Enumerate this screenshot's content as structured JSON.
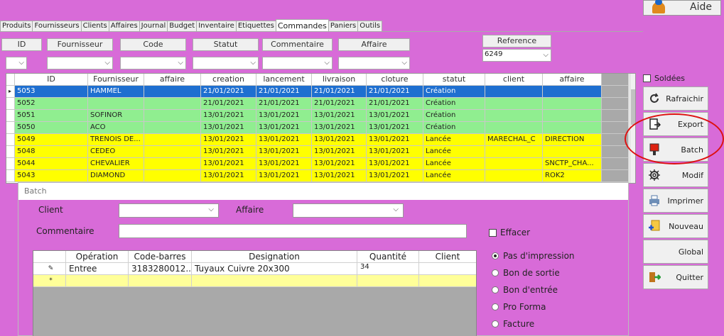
{
  "aide_label": "Aide",
  "tabs": [
    "Produits",
    "Fournisseurs",
    "Clients",
    "Affaires",
    "Journal",
    "Budget",
    "Inventaire",
    "Etiquettes",
    "Commandes",
    "Paniers",
    "Outils"
  ],
  "active_tab": "Commandes",
  "filters": {
    "id_label": "ID",
    "fournisseur_label": "Fournisseur",
    "code_label": "Code",
    "statut_label": "Statut",
    "commentaire_label": "Commentaire",
    "affaire_label": "Affaire",
    "reference_label": "Reference",
    "reference_value": "6249"
  },
  "grid": {
    "columns": [
      "ID",
      "Fournisseur",
      "affaire",
      "creation",
      "lancement",
      "livraison",
      "cloture",
      "statut",
      "client",
      "affaire"
    ],
    "rows": [
      {
        "cells": [
          "5053",
          "HAMMEL",
          "",
          "21/01/2021",
          "21/01/2021",
          "21/01/2021",
          "21/01/2021",
          "Création",
          "",
          ""
        ],
        "color": "#1e6fd0",
        "selected": true
      },
      {
        "cells": [
          "5052",
          "",
          "",
          "21/01/2021",
          "21/01/2021",
          "21/01/2021",
          "21/01/2021",
          "Création",
          "",
          ""
        ],
        "color": "#90ee90"
      },
      {
        "cells": [
          "5051",
          "SOFINOR",
          "",
          "13/01/2021",
          "13/01/2021",
          "13/01/2021",
          "13/01/2021",
          "Création",
          "",
          ""
        ],
        "color": "#90ee90"
      },
      {
        "cells": [
          "5050",
          "ACO",
          "",
          "13/01/2021",
          "13/01/2021",
          "13/01/2021",
          "13/01/2021",
          "Création",
          "",
          ""
        ],
        "color": "#90ee90"
      },
      {
        "cells": [
          "5049",
          "TRENOIS DE...",
          "",
          "13/01/2021",
          "13/01/2021",
          "13/01/2021",
          "13/01/2021",
          "Lancée",
          "MARECHAL_C",
          "DIRECTION"
        ],
        "color": "#ffff00"
      },
      {
        "cells": [
          "5048",
          "CEDEO",
          "",
          "13/01/2021",
          "13/01/2021",
          "13/01/2021",
          "13/01/2021",
          "Lancée",
          "",
          ""
        ],
        "color": "#ffff00"
      },
      {
        "cells": [
          "5044",
          "CHEVALIER",
          "",
          "13/01/2021",
          "13/01/2021",
          "13/01/2021",
          "13/01/2021",
          "Lancée",
          "",
          "SNCTP_CHA..."
        ],
        "color": "#ffff00"
      },
      {
        "cells": [
          "5043",
          "DIAMOND",
          "",
          "13/01/2021",
          "13/01/2021",
          "13/01/2021",
          "13/01/2021",
          "Lancée",
          "",
          "ROK2"
        ],
        "color": "#ffff00"
      }
    ]
  },
  "right_panel": {
    "soldees_label": "Soldées",
    "rafraichir": "Rafraichir",
    "export": "Export",
    "batch": "Batch",
    "modif": "Modif",
    "imprimer": "Imprimer",
    "nouveau": "Nouveau",
    "global": "Global",
    "quitter": "Quitter"
  },
  "batch_dialog": {
    "title": "Batch",
    "client_label": "Client",
    "affaire_label": "Affaire",
    "commentaire_label": "Commentaire",
    "effacer_label": "Effacer",
    "ops_columns": [
      "Opération",
      "Code-barres",
      "Designation",
      "Quantité",
      "Client"
    ],
    "ops_rows": [
      {
        "marker": "✎",
        "cells": [
          "Entree",
          "3183280012...",
          "Tuyaux Cuivre 20x300",
          "34",
          ""
        ]
      },
      {
        "marker": "*",
        "cells": [
          "",
          "",
          "",
          "",
          ""
        ]
      }
    ],
    "radios": [
      {
        "label": "Pas d'impression",
        "checked": true
      },
      {
        "label": "Bon de sortie",
        "checked": false
      },
      {
        "label": "Bon d'entrée",
        "checked": false
      },
      {
        "label": "Pro Forma",
        "checked": false
      },
      {
        "label": "Facture",
        "checked": false
      }
    ]
  }
}
